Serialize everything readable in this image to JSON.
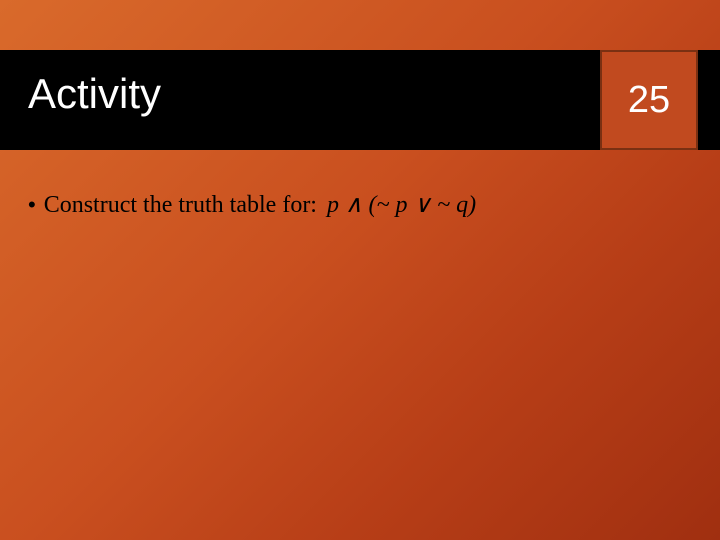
{
  "header": {
    "title": "Activity",
    "slide_number": "25"
  },
  "content": {
    "bullet_prefix": "•",
    "bullet_text": "Construct the truth table for:",
    "formula": "p ∧ (~ p ∨ ~ q)"
  }
}
